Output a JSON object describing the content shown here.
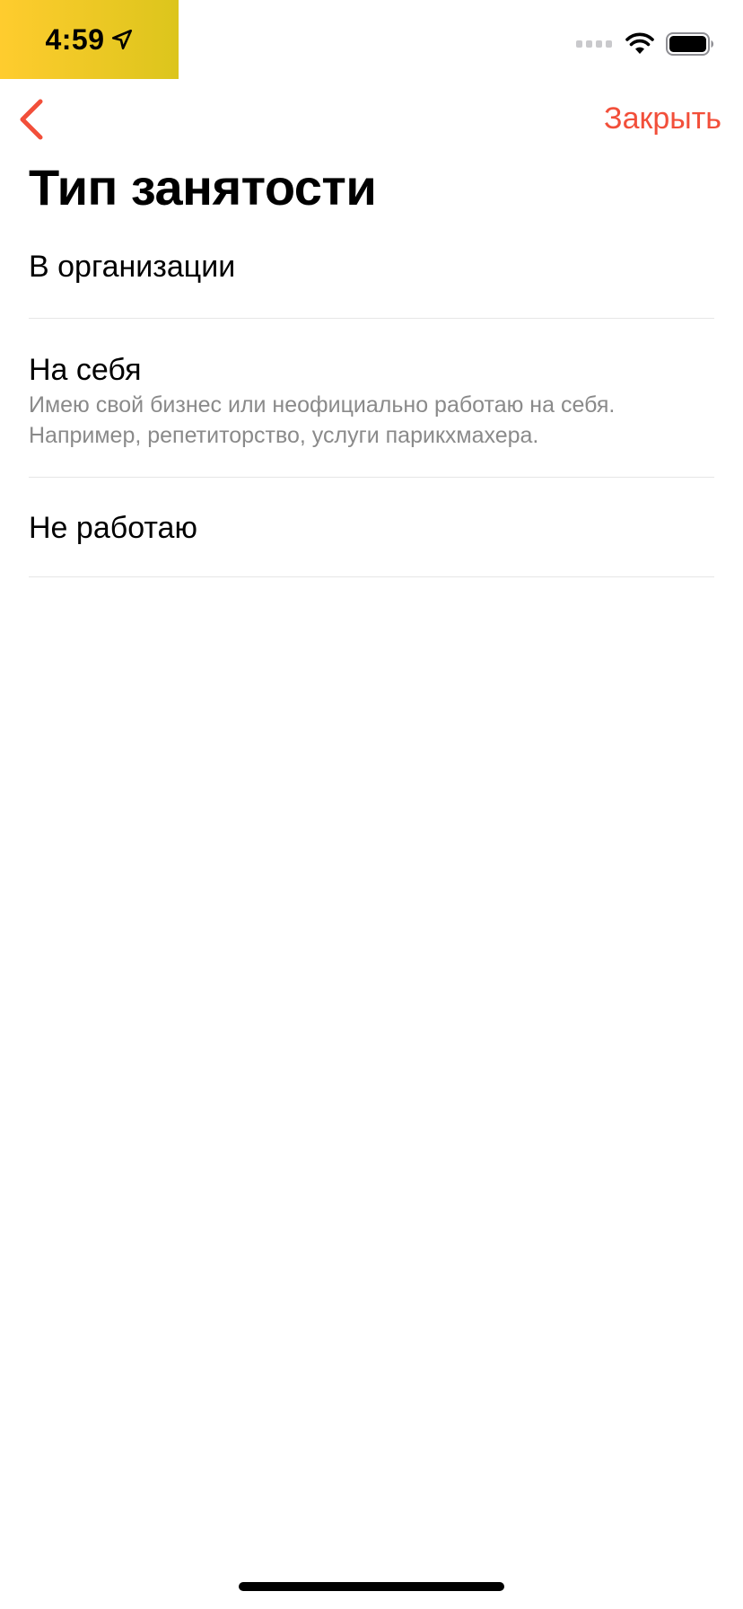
{
  "status_bar": {
    "time": "4:59"
  },
  "nav": {
    "close_label": "Закрыть"
  },
  "page": {
    "title": "Тип занятости"
  },
  "options": [
    {
      "title": "В организации"
    },
    {
      "title": "На себя",
      "subtitle_line1": "Имею свой бизнес или неофициально работаю на себя.",
      "subtitle_line2": "Например, репетиторство, услуги парикхмахера."
    },
    {
      "title": "Не работаю"
    }
  ],
  "icons": {
    "location": "location-arrow-icon",
    "signal": "cellular-signal-icon",
    "wifi": "wifi-icon",
    "battery": "battery-icon",
    "back": "chevron-left-icon"
  },
  "colors": {
    "accent": "#f24f3a",
    "status_pill_start": "#ffcc2e",
    "status_pill_end": "#dcc51c",
    "subtitle_text": "#8a8a8a",
    "divider": "#e6e6e6"
  }
}
